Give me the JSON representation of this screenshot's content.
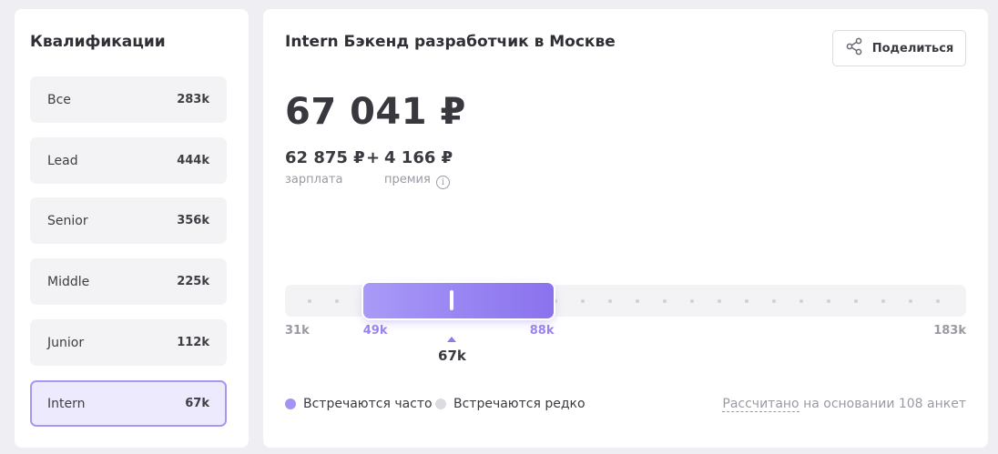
{
  "sidebar": {
    "title": "Квалификации",
    "items": [
      {
        "label": "Все",
        "value": "283k"
      },
      {
        "label": "Lead",
        "value": "444k"
      },
      {
        "label": "Senior",
        "value": "356k"
      },
      {
        "label": "Middle",
        "value": "225k"
      },
      {
        "label": "Junior",
        "value": "112k"
      },
      {
        "label": "Intern",
        "value": "67k"
      }
    ],
    "selected": "Intern"
  },
  "main": {
    "title": "Intern Бэкенд разработчик в Москве",
    "share_label": "Поделиться",
    "total_salary": "67 041 ₽",
    "base_salary": "62 875 ₽",
    "plus": "+",
    "bonus": "4 166 ₽",
    "base_label": "зарплата",
    "bonus_label": "премия",
    "info_glyph": "i"
  },
  "range": {
    "min": 31,
    "max": 183,
    "range_low": 49,
    "range_high": 88,
    "median": 67,
    "min_label": "31k",
    "max_label": "183k",
    "low_label": "49k",
    "high_label": "88k",
    "median_label": "67k"
  },
  "legend": {
    "often_label": "Встречаются часто",
    "rare_label": "Встречаются редко",
    "often_color": "#a393f2",
    "rare_color": "#dcdce0"
  },
  "footnote": {
    "link_text": "Рассчитано",
    "rest_text": " на основании 108 анкет"
  },
  "colors": {
    "accent": "#8f7aee",
    "background": "#efeff3"
  }
}
